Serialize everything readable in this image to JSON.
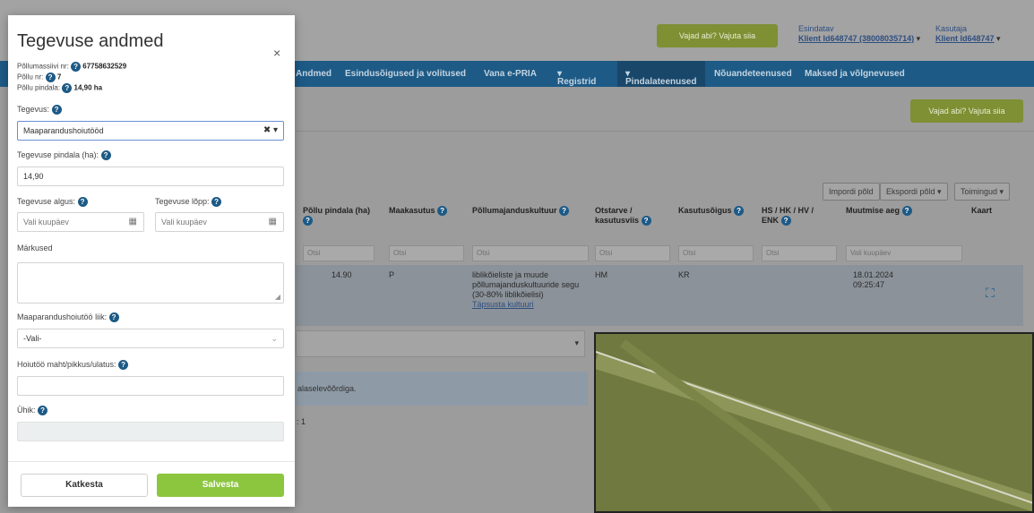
{
  "header": {
    "help_button": "Vajad abi? Vajuta siia",
    "representative_label": "Esindatav",
    "representative_name": "Klient Id648747 (38008035714)",
    "user_label": "Kasutaja",
    "user_name": "Klient Id648747"
  },
  "nav": {
    "items": [
      "Andmed",
      "Esindusõigused ja volitused",
      "Vana e-PRIA",
      "Registrid",
      "Pindalateenused",
      "Nõuandeteenused",
      "Maksed ja võlgnevused"
    ]
  },
  "toolbar": {
    "help_button": "Vajad abi? Vajuta siia",
    "import_label": "Impordi põld",
    "export_label": "Ekspordi põld",
    "actions_label": "Toimingud"
  },
  "table": {
    "headers": [
      "Põllu pindala (ha)",
      "Maakasutus",
      "Põllumajanduskultuur",
      "Otstarve / kasutusviis",
      "Kasutusõigus",
      "HS / HK / HV / ENK",
      "Muutmise aeg",
      "Kaart"
    ],
    "filter_placeholder": "Otsi",
    "date_placeholder": "Vali kuupäev",
    "row": {
      "area": "14.90",
      "land_use": "P",
      "crop": "liblikõieliste ja muude põllumajanduskultuuride segu (30-80% liblikõielisi)",
      "crop_link": "Täpsusta kultuuri",
      "purpose": "HM",
      "right_of_use": "KR",
      "modified_date": "18.01.2024",
      "modified_time": "09:25:47"
    }
  },
  "info_text": "alaselevõõrdiga.",
  "count_text": ": 1",
  "modal": {
    "title": "Tegevuse andmed",
    "close": "×",
    "field_register_label": "Põllumassiivi nr:",
    "field_register_value": "67758632529",
    "field_no_label": "Põllu nr:",
    "field_no_value": "7",
    "field_area_label": "Põllu pindala:",
    "field_area_value": "14,90 ha",
    "activity_label": "Tegevus:",
    "activity_value": "Maaparandushoiutööd",
    "activity_area_label": "Tegevuse pindala (ha):",
    "activity_area_value": "14,90",
    "start_label": "Tegevuse algus:",
    "start_placeholder": "Vali kuupäev",
    "end_label": "Tegevuse lõpp:",
    "end_placeholder": "Vali kuupäev",
    "notes_label": "Märkused",
    "work_type_label": "Maaparandushoiutöö liik:",
    "work_type_value": "-Vali-",
    "volume_label": "Hoiutöö maht/pikkus/ulatus:",
    "unit_label": "Ühik:",
    "cancel_button": "Katkesta",
    "save_button": "Salvesta"
  }
}
